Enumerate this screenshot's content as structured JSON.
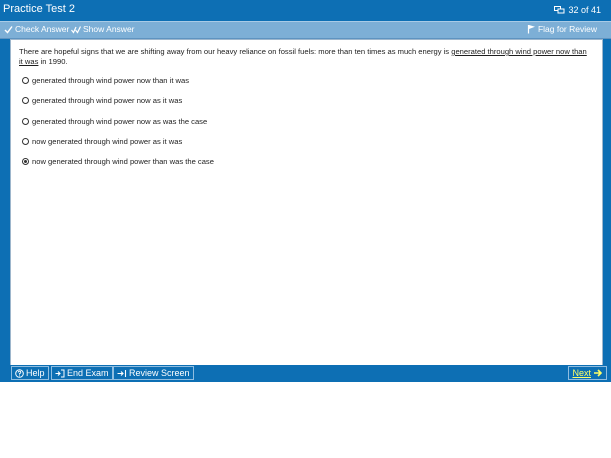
{
  "window": {
    "title": "Practice Test 2",
    "counter": "32 of 41"
  },
  "toolbar": {
    "check_answer": "Check Answer",
    "show_answer": "Show Answer",
    "flag_for_review": "Flag for Review"
  },
  "question": {
    "text_before": "There are hopeful signs that we are shifting away from our heavy reliance on fossil fuels:  more than ten times as much energy is ",
    "underlined_text": "generated through wind power now than it was",
    "text_after": " in 1990."
  },
  "choices": [
    {
      "label": "generated through wind power now than it was",
      "selected": false
    },
    {
      "label": "generated through wind power now as it was",
      "selected": false
    },
    {
      "label": "generated through wind power now as was the case",
      "selected": false
    },
    {
      "label": "now generated through wind power as it was",
      "selected": false
    },
    {
      "label": "now generated through wind power than was the case",
      "selected": true
    }
  ],
  "bottombar": {
    "help": "Help",
    "end_exam": "End Exam",
    "review_screen": "Review Screen",
    "next": "Next"
  },
  "colors": {
    "frame_blue": "#0d6fb4",
    "toolbar_blue": "#7dafd6",
    "next_yellow": "#ffff66"
  },
  "icons": {
    "counter": "screens-icon",
    "check_answer": "check-icon",
    "show_answer": "show-answer-icon",
    "flag": "flag-icon",
    "help": "help-circle-icon",
    "end_exam": "exit-icon",
    "review": "arrow-to-list-icon",
    "next": "arrow-right-icon"
  }
}
